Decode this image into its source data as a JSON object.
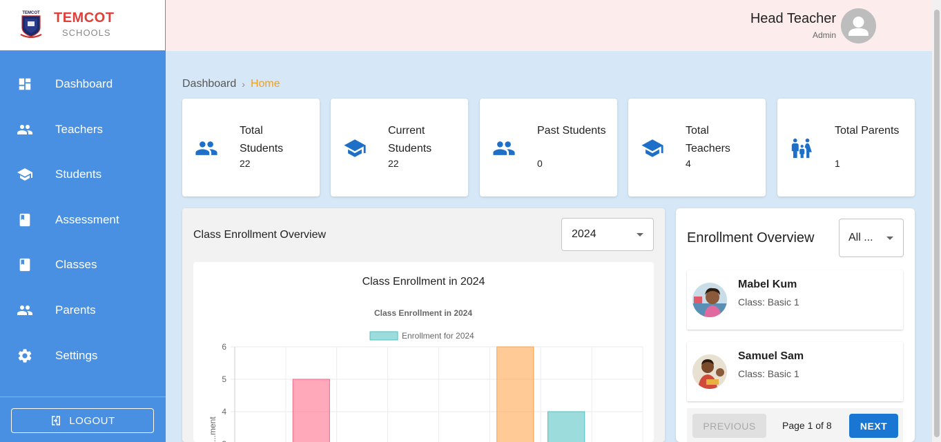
{
  "brand": {
    "name": "TEMCOT",
    "sub": "SCHOOLS",
    "crest_text": "TEMCOT"
  },
  "sidebar": {
    "items": [
      {
        "label": "Dashboard",
        "icon": "dashboard-icon"
      },
      {
        "label": "Teachers",
        "icon": "people-icon"
      },
      {
        "label": "Students",
        "icon": "school-icon"
      },
      {
        "label": "Assessment",
        "icon": "book-icon"
      },
      {
        "label": "Classes",
        "icon": "book-icon"
      },
      {
        "label": "Parents",
        "icon": "people-icon"
      },
      {
        "label": "Settings",
        "icon": "gear-icon"
      }
    ],
    "logout_label": "LOGOUT"
  },
  "header": {
    "user_name": "Head Teacher",
    "user_role": "Admin"
  },
  "breadcrumb": {
    "root": "Dashboard",
    "separator": "›",
    "current": "Home"
  },
  "stats": [
    {
      "label": "Total Students",
      "value": "22",
      "icon": "people-icon"
    },
    {
      "label": "Current Students",
      "value": "22",
      "icon": "school-icon"
    },
    {
      "label": "Past Students",
      "value": "0",
      "icon": "people-icon"
    },
    {
      "label": "Total Teachers",
      "value": "4",
      "icon": "school-icon"
    },
    {
      "label": "Total Parents",
      "value": "1",
      "icon": "family-icon"
    }
  ],
  "class_enrollment": {
    "panel_title": "Class Enrollment Overview",
    "year_select": "2024",
    "chart_heading": "Class Enrollment in 2024"
  },
  "chart_data": {
    "type": "bar",
    "title": "Class Enrollment in 2024",
    "legend": [
      "Enrollment for 2024"
    ],
    "legend_placement": "top",
    "ylabel": "...ment",
    "ylim": [
      0,
      6
    ],
    "y_ticks": [
      "6",
      "5",
      "4",
      "3"
    ],
    "categories": [
      "",
      "",
      "",
      "",
      "",
      "",
      "",
      ""
    ],
    "series": [
      {
        "name": "Enrollment for 2024",
        "values": [
          0,
          5,
          0,
          0,
          0,
          6,
          4,
          0
        ]
      }
    ],
    "bar_colors": [
      "#4bc0c0",
      "#ff6384",
      "#4bc0c0",
      "#4bc0c0",
      "#4bc0c0",
      "#ff9f40",
      "#4bc0c0",
      "#4bc0c0"
    ],
    "legend_color": "#4bc0c0",
    "grid": true
  },
  "enrollment_overview": {
    "title": "Enrollment Overview",
    "filter_select": "All ...",
    "students": [
      {
        "name": "Mabel Kum",
        "class": "Class: Basic 1"
      },
      {
        "name": "Samuel Sam",
        "class": "Class: Basic 1"
      }
    ],
    "prev_label": "PREVIOUS",
    "next_label": "NEXT",
    "page_info": "Page 1 of 8"
  },
  "colors": {
    "sidebar": "#4a90e2",
    "header": "#fcecec",
    "background": "#d6e8f7",
    "accent": "#1976d2",
    "breadcrumb_current": "#f0a020",
    "brand_red": "#e0403a"
  }
}
